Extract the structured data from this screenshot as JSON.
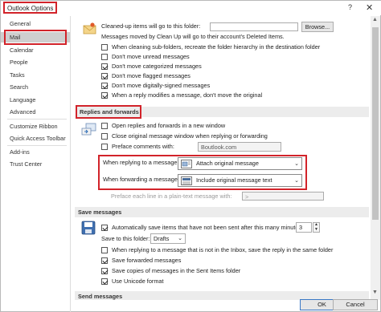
{
  "window": {
    "title": "Outlook Options",
    "help_icon": "?",
    "close_icon": "✕"
  },
  "sidebar": {
    "items": [
      {
        "label": "General"
      },
      {
        "label": "Mail",
        "selected": true
      },
      {
        "label": "Calendar"
      },
      {
        "label": "People"
      },
      {
        "label": "Tasks"
      },
      {
        "label": "Search"
      },
      {
        "label": "Language"
      },
      {
        "label": "Advanced"
      },
      {
        "label": "Customize Ribbon"
      },
      {
        "label": "Quick Access Toolbar"
      },
      {
        "label": "Add-ins"
      },
      {
        "label": "Trust Center"
      }
    ]
  },
  "cleanup": {
    "folder_label": "Cleaned-up items will go to this folder:",
    "browse_label": "Browse...",
    "moved_note": "Messages moved by Clean Up will go to their account's Deleted Items.",
    "options": [
      {
        "label": "When cleaning sub-folders, recreate the folder hierarchy in the destination folder",
        "checked": false
      },
      {
        "label": "Don't move unread messages",
        "checked": false
      },
      {
        "label": "Don't move categorized messages",
        "checked": true
      },
      {
        "label": "Don't move flagged messages",
        "checked": true
      },
      {
        "label": "Don't move digitally-signed messages",
        "checked": true
      },
      {
        "label": "When a reply modifies a message, don't move the original",
        "checked": true
      }
    ]
  },
  "replies": {
    "header": "Replies and forwards",
    "options": [
      {
        "label": "Open replies and forwards in a new window",
        "checked": false
      },
      {
        "label": "Close original message window when replying or forwarding",
        "checked": false
      },
      {
        "label": "Preface comments with:",
        "checked": false
      }
    ],
    "preface_value": "Boutlook.com",
    "reply_label": "When replying to a message:",
    "reply_value": "Attach original message",
    "forward_label": "When forwarding a message:",
    "forward_value": "Include original message text",
    "prefix_label": "Preface each line in a plain-text message with:",
    "prefix_value": ">"
  },
  "save": {
    "header": "Save messages",
    "auto_label": "Automatically save items that have not been sent after this many minutes:",
    "auto_checked": true,
    "minutes": "3",
    "folder_label": "Save to this folder:",
    "folder_value": "Drafts",
    "options": [
      {
        "label": "When replying to a message that is not in the Inbox, save the reply in the same folder",
        "checked": false
      },
      {
        "label": "Save forwarded messages",
        "checked": true
      },
      {
        "label": "Save copies of messages in the Sent Items folder",
        "checked": true
      },
      {
        "label": "Use Unicode format",
        "checked": true
      }
    ]
  },
  "send": {
    "header": "Send messages"
  },
  "footer": {
    "ok_label": "OK",
    "cancel_label": "Cancel"
  },
  "colors": {
    "highlight": "#d2232a",
    "section_bg": "#ececec",
    "selected_nav": "#cfcfcf"
  }
}
